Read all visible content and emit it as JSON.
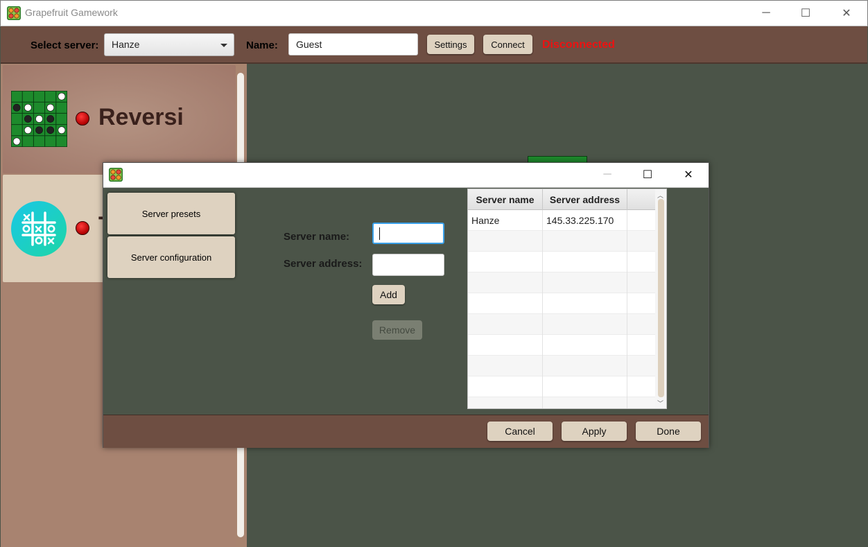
{
  "window": {
    "title": "Grapefruit Gamework",
    "minimize_glyph": "─",
    "maximize_glyph": "☐",
    "close_glyph": "✕"
  },
  "toolbar": {
    "select_server_label": "Select server:",
    "selected_server": "Hanze",
    "name_label": "Name:",
    "name_value": "Guest",
    "settings_label": "Settings",
    "connect_label": "Connect",
    "status": "Disconnected",
    "status_color": "#ee1111"
  },
  "games": [
    {
      "title": "Reversi",
      "icon": "reversi-board-icon",
      "status_color": "#cc0000"
    },
    {
      "title": "T",
      "icon": "tic-tac-toe-icon",
      "status_color": "#cc0000"
    }
  ],
  "dialog": {
    "tabs": [
      "Server presets",
      "Server configuration"
    ],
    "server_name_label": "Server name:",
    "server_address_label": "Server address:",
    "server_name_value": "",
    "server_address_value": "",
    "add_label": "Add",
    "remove_label": "Remove",
    "table": {
      "columns": [
        "Server name",
        "Server address"
      ],
      "rows": [
        [
          "Hanze",
          "145.33.225.170"
        ]
      ]
    },
    "cancel_label": "Cancel",
    "apply_label": "Apply",
    "done_label": "Done"
  },
  "colors": {
    "toolbar_bg": "#6e4e42",
    "accent_beige": "#ded2c0",
    "workspace_bg": "#4b5448"
  }
}
